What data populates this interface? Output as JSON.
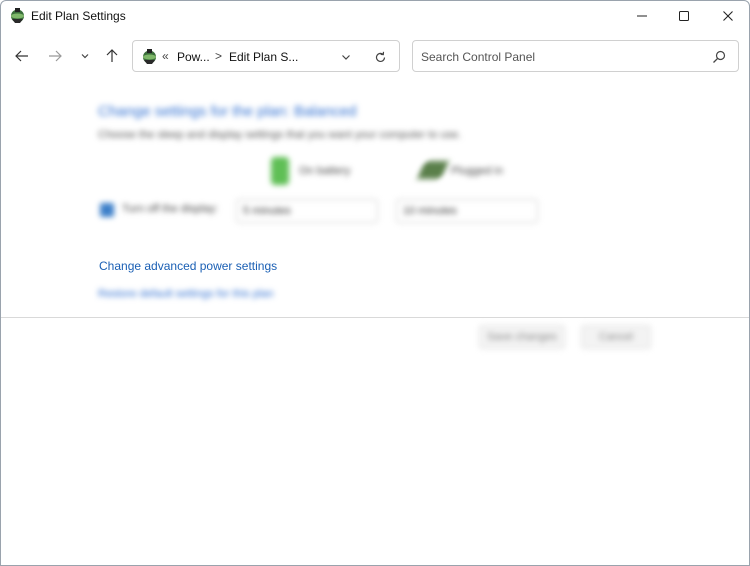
{
  "window": {
    "title": "Edit Plan Settings",
    "controls": {
      "minimize": "—",
      "maximize": "☐",
      "close": "✕"
    }
  },
  "nav": {
    "back": "←",
    "forward": "→",
    "recent": "⌄",
    "up": "↑"
  },
  "address": {
    "overflow": "«",
    "crumbs": [
      "Pow...",
      "Edit Plan S..."
    ],
    "separator": ">",
    "dropdown_icon": "chevron-down-icon",
    "refresh_icon": "refresh-icon"
  },
  "search": {
    "placeholder": "Search Control Panel",
    "value": "",
    "icon": "search-icon"
  },
  "content": {
    "heading": "Change settings for the plan: Balanced",
    "subtext": "Choose the sleep and display settings that you want your computer to use.",
    "battery_label": "On battery",
    "plugged_label": "Plugged in",
    "display_label": "Turn off the display:",
    "battery_value": "5 minutes",
    "plugged_value": "10 minutes",
    "advanced_link": "Change advanced power settings",
    "restore_link": "Restore default settings for this plan"
  },
  "footer": {
    "save": "Save changes",
    "cancel": "Cancel"
  },
  "colors": {
    "link": "#1a5fb4",
    "heading_blur": "#2f6fd1",
    "battery": "#5fbf55"
  }
}
